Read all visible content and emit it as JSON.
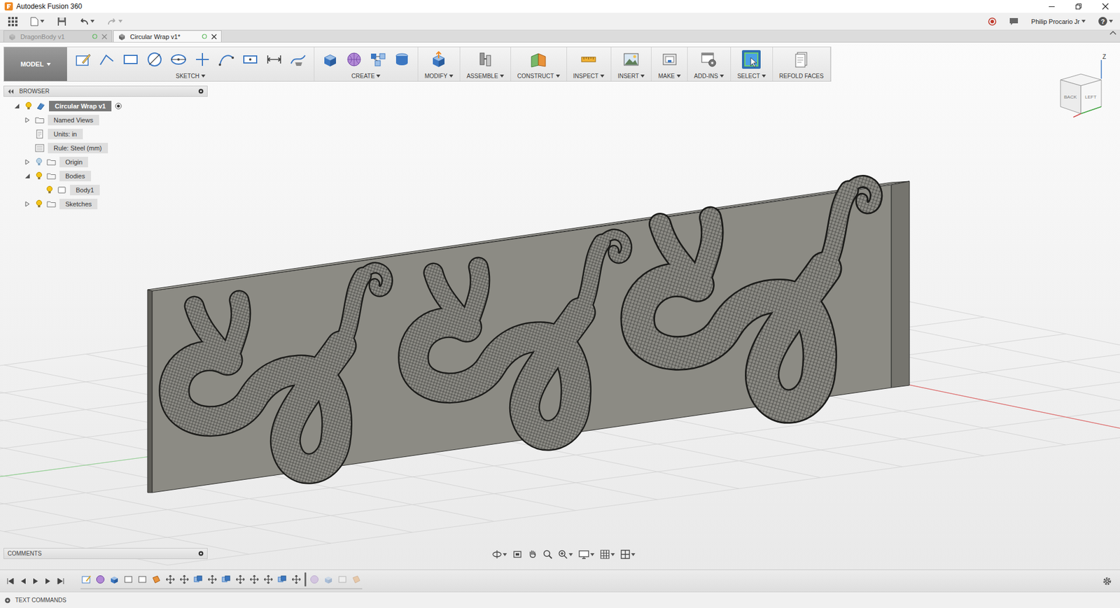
{
  "window": {
    "title": "Autodesk Fusion 360"
  },
  "account": {
    "user": "Philip Procario Jr",
    "help": "?"
  },
  "documentTabs": [
    {
      "label": "DragonBody v1",
      "selected": false
    },
    {
      "label": "Circular Wrap v1*",
      "selected": true
    }
  ],
  "toolbar": {
    "workspace": "MODEL",
    "groups": [
      {
        "label": "SKETCH",
        "dropdown": true,
        "selected": false
      },
      {
        "label": "CREATE",
        "dropdown": true,
        "selected": false
      },
      {
        "label": "MODIFY",
        "dropdown": true,
        "selected": false
      },
      {
        "label": "ASSEMBLE",
        "dropdown": true,
        "selected": false
      },
      {
        "label": "CONSTRUCT",
        "dropdown": true,
        "selected": false
      },
      {
        "label": "INSPECT",
        "dropdown": true,
        "selected": false
      },
      {
        "label": "INSERT",
        "dropdown": true,
        "selected": false
      },
      {
        "label": "MAKE",
        "dropdown": true,
        "selected": false
      },
      {
        "label": "ADD-INS",
        "dropdown": true,
        "selected": false
      },
      {
        "label": "SELECT",
        "dropdown": true,
        "selected": true
      },
      {
        "label": "REFOLD FACES",
        "dropdown": false,
        "selected": false
      }
    ]
  },
  "browser": {
    "title": "BROWSER",
    "items": [
      {
        "label": "Circular Wrap v1",
        "kind": "component",
        "depth": 0,
        "hasChildren": true,
        "expanded": true,
        "hasBulb": true,
        "visible": true,
        "active": true
      },
      {
        "label": "Named Views",
        "kind": "folder",
        "depth": 1,
        "hasChildren": true,
        "expanded": false,
        "hasBulb": false,
        "visible": true,
        "active": false
      },
      {
        "label": "Units: in",
        "kind": "units",
        "depth": 1,
        "hasChildren": false,
        "expanded": false,
        "hasBulb": false,
        "visible": true,
        "active": false
      },
      {
        "label": "Rule: Steel (mm)",
        "kind": "rule",
        "depth": 1,
        "hasChildren": false,
        "expanded": false,
        "hasBulb": false,
        "visible": true,
        "active": false
      },
      {
        "label": "Origin",
        "kind": "folder",
        "depth": 1,
        "hasChildren": true,
        "expanded": false,
        "hasBulb": true,
        "visible": false,
        "active": false
      },
      {
        "label": "Bodies",
        "kind": "folder",
        "depth": 1,
        "hasChildren": true,
        "expanded": true,
        "hasBulb": true,
        "visible": true,
        "active": false
      },
      {
        "label": "Body1",
        "kind": "body",
        "depth": 2,
        "hasChildren": false,
        "expanded": false,
        "hasBulb": true,
        "visible": true,
        "active": false
      },
      {
        "label": "Sketches",
        "kind": "folder",
        "depth": 1,
        "hasChildren": true,
        "expanded": false,
        "hasBulb": true,
        "visible": true,
        "active": false
      }
    ]
  },
  "viewCube": {
    "top": "Z",
    "faces": [
      "BACK",
      "LEFT"
    ]
  },
  "comments": {
    "title": "COMMENTS"
  },
  "timeline": {
    "features": [
      {
        "kind": "sketch",
        "rolledBack": false
      },
      {
        "kind": "form",
        "rolledBack": false
      },
      {
        "kind": "extrude",
        "rolledBack": false
      },
      {
        "kind": "body",
        "rolledBack": false
      },
      {
        "kind": "body",
        "rolledBack": false
      },
      {
        "kind": "plane",
        "rolledBack": false
      },
      {
        "kind": "move",
        "rolledBack": false
      },
      {
        "kind": "move",
        "rolledBack": false
      },
      {
        "kind": "combine",
        "rolledBack": false
      },
      {
        "kind": "move",
        "rolledBack": false
      },
      {
        "kind": "combine",
        "rolledBack": false
      },
      {
        "kind": "move",
        "rolledBack": false
      },
      {
        "kind": "move",
        "rolledBack": false
      },
      {
        "kind": "move",
        "rolledBack": false
      },
      {
        "kind": "combine",
        "rolledBack": false
      },
      {
        "kind": "move",
        "rolledBack": false
      },
      {
        "kind": "form",
        "rolledBack": true
      },
      {
        "kind": "extrude",
        "rolledBack": true
      },
      {
        "kind": "body",
        "rolledBack": true
      },
      {
        "kind": "plane",
        "rolledBack": true
      }
    ]
  },
  "textCommands": {
    "title": "TEXT COMMANDS"
  }
}
